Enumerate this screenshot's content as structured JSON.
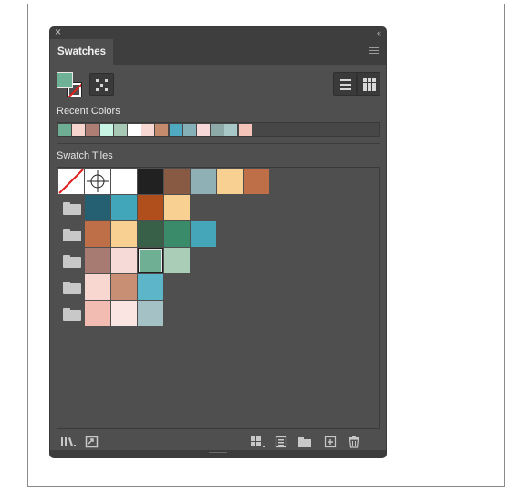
{
  "panel": {
    "tab_label": "Swatches",
    "close_glyph": "×",
    "collapse_glyph": "‹‹"
  },
  "fill_stroke": {
    "fill_color": "#6fb196",
    "stroke": "none"
  },
  "sections": {
    "recent_label": "Recent Colors",
    "tiles_label": "Swatch Tiles"
  },
  "recent_colors": [
    "#6fae94",
    "#f6d5ce",
    "#ae7e74",
    "#c8f5e3",
    "#a7c8b5",
    "#ffffff",
    "#f8d8d3",
    "#c48b6d",
    "#4fa9c0",
    "#86b0b8",
    "#f6d8d8",
    "#8eaaa8",
    "#a8c8c8",
    "#f5c4b8"
  ],
  "swatch_tiles": {
    "row1": [
      "none",
      "registration",
      "#ffffff",
      "#212121",
      "#885a44",
      "#8fb0b5",
      "#f7d092",
      "#bf6f48"
    ],
    "groups": [
      [
        "#246072",
        "#41a6b9",
        "#b04f1c",
        "#f7d092"
      ],
      [
        "#bf6f48",
        "#f7d092",
        "#385f48",
        "#3a8b6a",
        "#45a6b9"
      ],
      [
        "#a77b71",
        "#f6dad7",
        "#6fb094",
        "#aacdb8"
      ],
      [
        "#f7d7d0",
        "#c88f74",
        "#5cb5c9"
      ],
      [
        "#f2bcb3",
        "#fbe5e2",
        "#a4c2c6"
      ]
    ],
    "selected": "#6fb094"
  },
  "bottom_icons": [
    "swatch-libraries-icon",
    "place-swatch-icon",
    "swatch-kind-menu-icon",
    "swatch-options-icon",
    "new-color-group-icon",
    "new-swatch-icon",
    "delete-swatch-icon"
  ]
}
